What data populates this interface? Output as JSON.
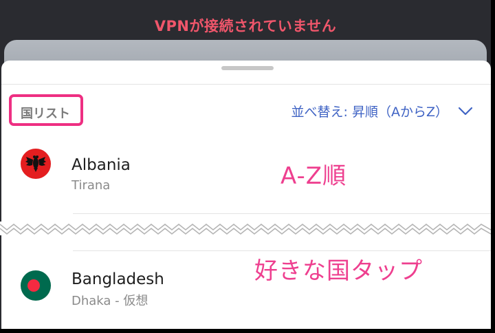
{
  "status": {
    "text": "VPNが接続されていません",
    "color": "#f0566b"
  },
  "list_header": {
    "title": "国リスト",
    "sort_label": "並べ替え: 昇順（AからZ）",
    "sort_icon": "chevron-down-icon"
  },
  "countries": [
    {
      "name": "Albania",
      "capital": "Tirana",
      "flag": "albania-flag-icon",
      "flag_color": "#e41e20"
    },
    {
      "name": "Bangladesh",
      "capital": "Dhaka - 仮想",
      "flag": "bangladesh-flag-icon",
      "flag_color": "#006a4e",
      "flag_disc_color": "#f42a41"
    }
  ],
  "annotations": {
    "sort_note": "A-Z順",
    "tap_note": "好きな国タップ",
    "highlight_color": "#ee2f82"
  }
}
